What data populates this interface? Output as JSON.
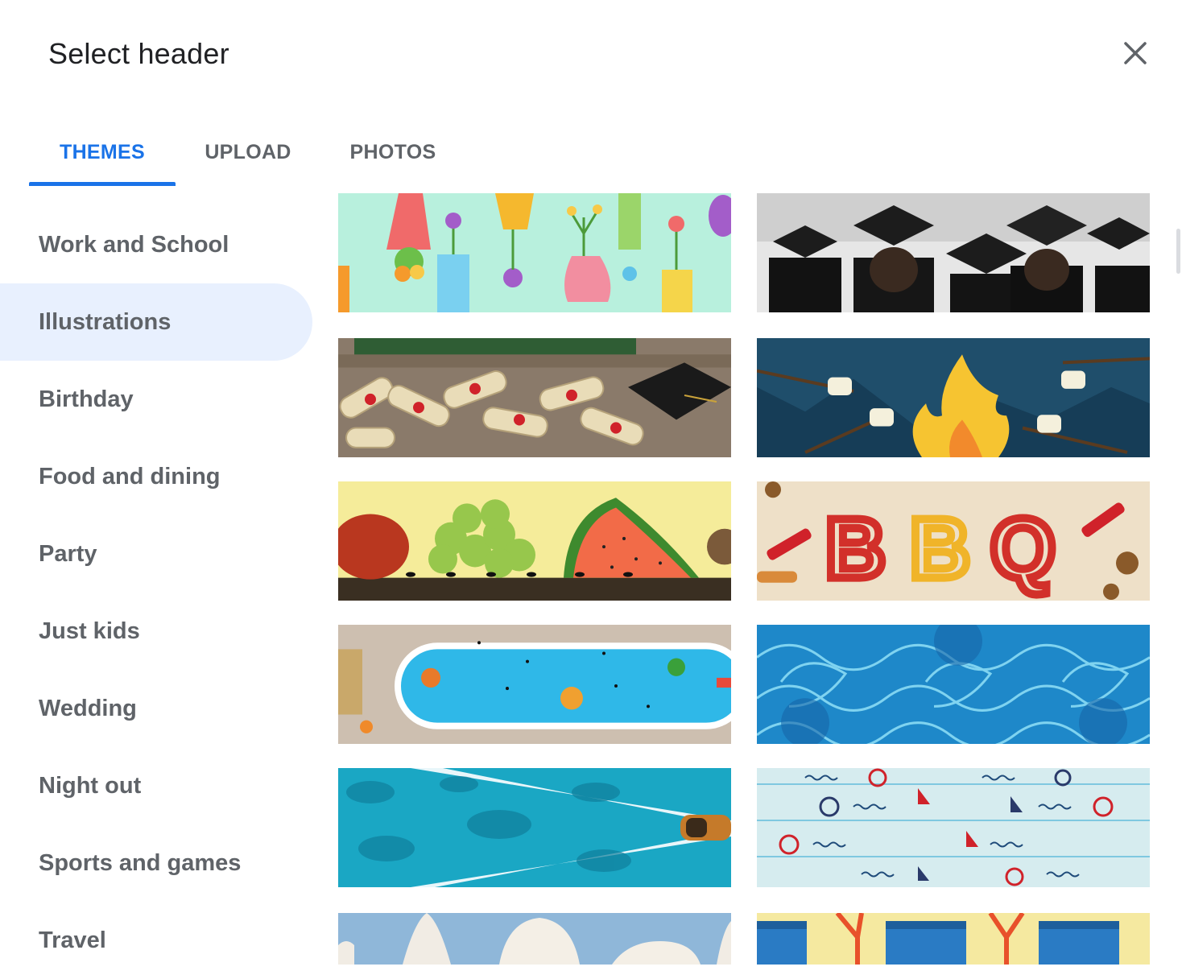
{
  "dialog": {
    "title": "Select header",
    "close_icon": "close-icon"
  },
  "tabs": [
    {
      "label": "THEMES",
      "active": true
    },
    {
      "label": "UPLOAD",
      "active": false
    },
    {
      "label": "PHOTOS",
      "active": false
    }
  ],
  "categories": [
    {
      "label": "Work and School",
      "active": false
    },
    {
      "label": "Illustrations",
      "active": true
    },
    {
      "label": "Birthday",
      "active": false
    },
    {
      "label": "Food and dining",
      "active": false
    },
    {
      "label": "Party",
      "active": false
    },
    {
      "label": "Just kids",
      "active": false
    },
    {
      "label": "Wedding",
      "active": false
    },
    {
      "label": "Night out",
      "active": false
    },
    {
      "label": "Sports and games",
      "active": false
    },
    {
      "label": "Travel",
      "active": false
    }
  ],
  "headers": [
    {
      "theme": "flower-pots",
      "bg": "#b8f0dd"
    },
    {
      "theme": "graduation-caps",
      "bg": "#dcdcdc"
    },
    {
      "theme": "diploma-scrolls",
      "bg": "#8a7a6a"
    },
    {
      "theme": "campfire-marshmallows",
      "bg": "#1f4e6b"
    },
    {
      "theme": "picnic-ants",
      "bg": "#f5ec9a"
    },
    {
      "theme": "bbq",
      "bg": "#eee0c8",
      "text": "BBQ"
    },
    {
      "theme": "swimming-pool",
      "bg": "#cdbfb0"
    },
    {
      "theme": "ocean-waves",
      "bg": "#1e88c9"
    },
    {
      "theme": "speedboat-water",
      "bg": "#1aa7c4"
    },
    {
      "theme": "nautical-pattern",
      "bg": "#d6ecef"
    },
    {
      "theme": "seashells",
      "bg": "#8fb7d9"
    },
    {
      "theme": "sand-buckets",
      "bg": "#f5e9a0"
    }
  ],
  "colors": {
    "accent": "#1a73e8",
    "selected_bg": "#e8f0fe",
    "text_muted": "#5f6368"
  }
}
